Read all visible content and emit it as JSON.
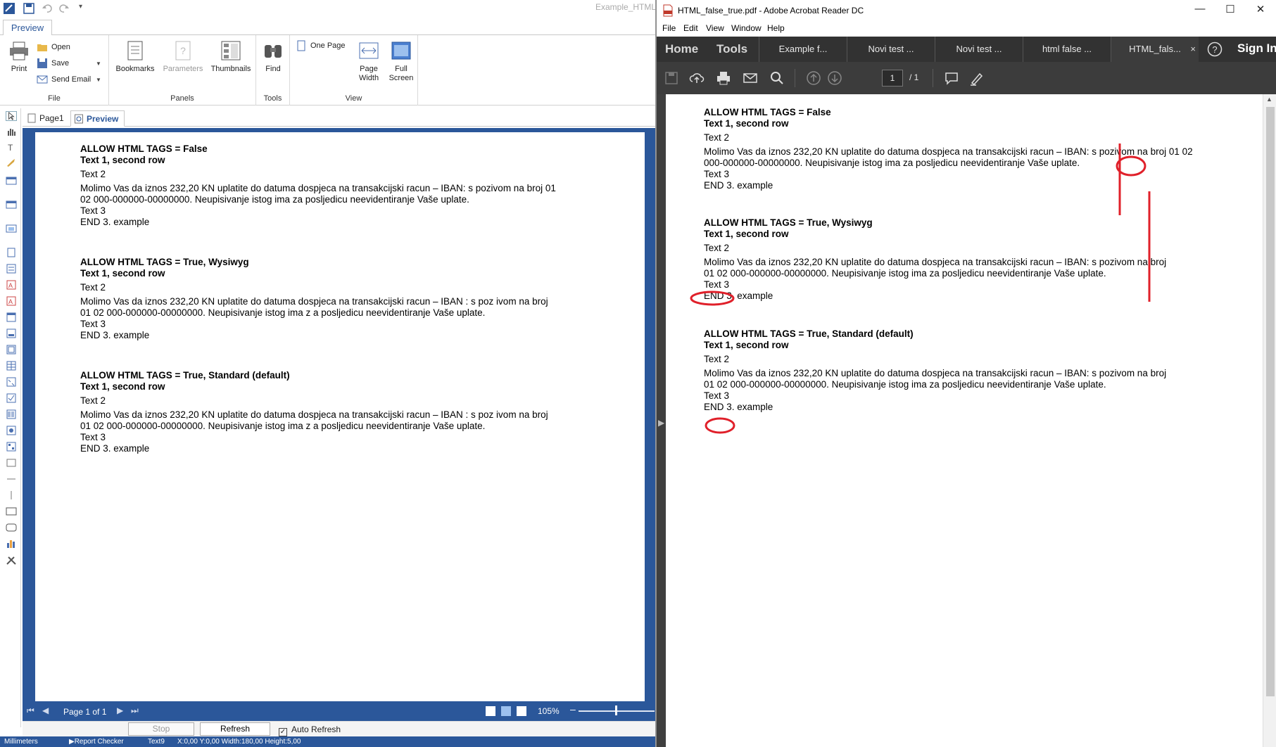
{
  "designer": {
    "window_title": "Example_HTML",
    "ribbon_tab": "Preview",
    "ribbon": {
      "file": {
        "print": "Print",
        "open": "Open",
        "save": "Save",
        "send_email": "Send Email",
        "group": "File"
      },
      "panels": {
        "bookmarks": "Bookmarks",
        "parameters": "Parameters",
        "thumbnails": "Thumbnails",
        "group": "Panels"
      },
      "tools": {
        "find": "Find",
        "group": "Tools"
      },
      "view": {
        "one_page": "One Page",
        "page_width_1": "Page",
        "page_width_2": "Width",
        "full_screen_1": "Full",
        "full_screen_2": "Screen",
        "group": "View"
      }
    },
    "doc_tabs": {
      "page1": "Page1",
      "preview": "Preview"
    },
    "report": [
      {
        "heading": "ALLOW HTML TAGS = False",
        "row2": "Text 1, second row",
        "text2": "Text 2",
        "line1": "Molimo Vas da iznos 232,20 KN uplatite do datuma dospjeca na transakcijski racun – IBAN: s pozivom na broj 01",
        "line2": "02 000-000000-00000000. Neupisivanje istog ima za posljedicu neevidentiranje Vaše uplate.",
        "text3": "Text 3",
        "end": "END 3. example"
      },
      {
        "heading": "ALLOW HTML TAGS = True, Wysiwyg",
        "row2": "Text 1, second row",
        "text2": "Text 2",
        "line1": "Molimo Vas da iznos 232,20 KN uplatite do datuma dospjeca na transakcijski racun – IBAN : s poz ivom na broj",
        "line2": "01 02 000-000000-00000000. Neupisivanje istog ima z a posljedicu neevidentiranje Vaše uplate.",
        "text3": "Text 3",
        "end": "END 3. example"
      },
      {
        "heading": "ALLOW HTML TAGS = True, Standard (default)",
        "row2": "Text 1, second row",
        "text2": "Text 2",
        "line1": "Molimo Vas da iznos 232,20 KN uplatite do datuma dospjeca na transakcijski racun – IBAN : s poz ivom na broj",
        "line2": "01 02 000-000000-00000000. Neupisivanje istog ima z a posljedicu neevidentiranje Vaše uplate.",
        "text3": "Text 3",
        "end": "END 3. example"
      }
    ],
    "nav": {
      "page_label": "Page 1 of 1",
      "zoom": "105%"
    },
    "refresh": {
      "stop": "Stop",
      "refresh": "Refresh",
      "auto_refresh": "Auto Refresh"
    },
    "status": {
      "units": "Millimeters",
      "checker": "Report Checker",
      "component": "Text9",
      "coords": "X:0,00  Y:0,00  Width:180,00  Height:5,00"
    }
  },
  "acrobat": {
    "title": "HTML_false_true.pdf - Adobe Acrobat Reader DC",
    "menu": [
      "File",
      "Edit",
      "View",
      "Window",
      "Help"
    ],
    "main_tabs": {
      "home": "Home",
      "tools": "Tools"
    },
    "doc_tabs": [
      "Example f...",
      "Novi test ...",
      "Novi test ...",
      "html false ...",
      "HTML_fals..."
    ],
    "close_tab": "×",
    "sign_in": "Sign In",
    "page_current": "1",
    "page_total": "/ 1",
    "pdf": [
      {
        "heading": "ALLOW HTML TAGS = False",
        "row2": "Text 1, second row",
        "text2": "Text 2",
        "line1": "Molimo Vas da iznos 232,20 KN uplatite do datuma dospjeca na transakcijski racun – IBAN: s pozivom na broj 01 02",
        "line2": "000-000000-00000000. Neupisivanje istog ima za posljedicu neevidentiranje Vaše uplate.",
        "text3": "Text 3",
        "end": "END 3. example"
      },
      {
        "heading": "ALLOW HTML TAGS = True, Wysiwyg",
        "row2": "Text 1, second row",
        "text2": "Text 2",
        "line1": "Molimo Vas da iznos 232,20 KN uplatite do datuma dospjeca na transakcijski racun – IBAN: s pozivom na broj",
        "line2": "01 02 000-000000-00000000. Neupisivanje istog ima za posljedicu neevidentiranje Vaše uplate.",
        "text3": "Text 3",
        "end": "END 3. example"
      },
      {
        "heading": "ALLOW HTML TAGS = True, Standard (default)",
        "row2": "Text 1, second row",
        "text2": "Text 2",
        "line1": "Molimo Vas da iznos 232,20 KN uplatite do datuma dospjeca na transakcijski racun – IBAN: s pozivom na broj",
        "line2": "01 02 000-000000-00000000. Neupisivanje istog ima za posljedicu neevidentiranje Vaše uplate.",
        "text3": "Text 3",
        "end": "END 3. example"
      }
    ]
  },
  "colors": {
    "accent": "#2b579a",
    "annotation": "#e0202a",
    "acrobat_dark": "#323232"
  }
}
